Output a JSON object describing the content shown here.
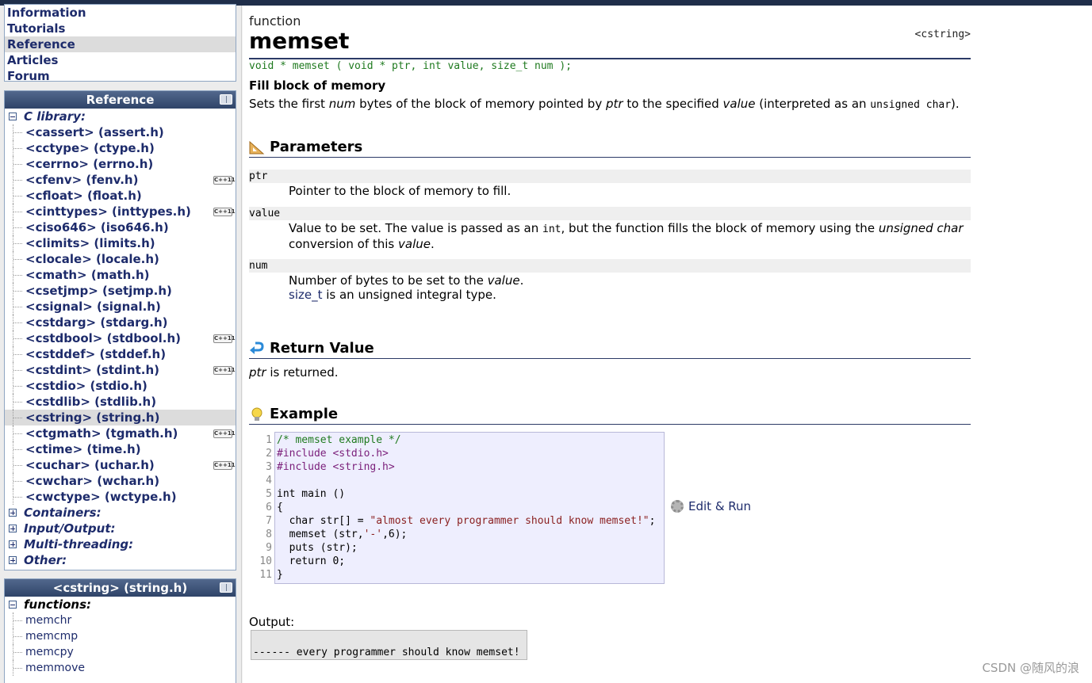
{
  "nav": {
    "items": [
      "Information",
      "Tutorials",
      "Reference",
      "Articles",
      "Forum"
    ],
    "active_index": 2
  },
  "reference_panel": {
    "title": "Reference",
    "c_library": "C library:",
    "headers": [
      {
        "label": "<cassert> (assert.h)",
        "cpp11": false
      },
      {
        "label": "<cctype> (ctype.h)",
        "cpp11": false
      },
      {
        "label": "<cerrno> (errno.h)",
        "cpp11": false
      },
      {
        "label": "<cfenv> (fenv.h)",
        "cpp11": true
      },
      {
        "label": "<cfloat> (float.h)",
        "cpp11": false
      },
      {
        "label": "<cinttypes> (inttypes.h)",
        "cpp11": true
      },
      {
        "label": "<ciso646> (iso646.h)",
        "cpp11": false
      },
      {
        "label": "<climits> (limits.h)",
        "cpp11": false
      },
      {
        "label": "<clocale> (locale.h)",
        "cpp11": false
      },
      {
        "label": "<cmath> (math.h)",
        "cpp11": false
      },
      {
        "label": "<csetjmp> (setjmp.h)",
        "cpp11": false
      },
      {
        "label": "<csignal> (signal.h)",
        "cpp11": false
      },
      {
        "label": "<cstdarg> (stdarg.h)",
        "cpp11": false
      },
      {
        "label": "<cstdbool> (stdbool.h)",
        "cpp11": true
      },
      {
        "label": "<cstddef> (stddef.h)",
        "cpp11": false
      },
      {
        "label": "<cstdint> (stdint.h)",
        "cpp11": true
      },
      {
        "label": "<cstdio> (stdio.h)",
        "cpp11": false
      },
      {
        "label": "<cstdlib> (stdlib.h)",
        "cpp11": false
      },
      {
        "label": "<cstring> (string.h)",
        "cpp11": false
      },
      {
        "label": "<ctgmath> (tgmath.h)",
        "cpp11": true
      },
      {
        "label": "<ctime> (time.h)",
        "cpp11": false
      },
      {
        "label": "<cuchar> (uchar.h)",
        "cpp11": true
      },
      {
        "label": "<cwchar> (wchar.h)",
        "cpp11": false
      },
      {
        "label": "<cwctype> (wctype.h)",
        "cpp11": false
      }
    ],
    "active_index": 18,
    "cpp11_badge": "C++11",
    "categories": [
      "Containers:",
      "Input/Output:",
      "Multi-threading:",
      "Other:"
    ]
  },
  "cstring_panel": {
    "title": "<cstring> (string.h)",
    "functions_label": "functions:",
    "functions": [
      "memchr",
      "memcmp",
      "memcpy",
      "memmove"
    ]
  },
  "page": {
    "kind": "function",
    "title": "memset",
    "header": "<cstring>",
    "prototype": "void * memset ( void * ptr, int value, size_t num );",
    "summary": "Fill block of memory",
    "desc_1": "Sets the first ",
    "desc_num": "num",
    "desc_2": " bytes of the block of memory pointed by ",
    "desc_ptr": "ptr",
    "desc_3": " to the specified ",
    "desc_value": "value",
    "desc_4": " (interpreted as an ",
    "desc_code": "unsigned char",
    "desc_5": ")."
  },
  "parameters": {
    "heading": "Parameters",
    "ptr_name": "ptr",
    "ptr_desc": "Pointer to the block of memory to fill.",
    "value_name": "value",
    "value_desc_1": "Value to be set. The value is passed as an ",
    "value_desc_int": "int",
    "value_desc_2": ", but the function fills the block of memory using the ",
    "value_desc_uc": "unsigned char",
    "value_desc_3": "conversion of this ",
    "value_desc_value": "value",
    "value_desc_4": ".",
    "num_name": "num",
    "num_desc_1": "Number of bytes to be set to the ",
    "num_desc_value": "value",
    "num_desc_2": ".",
    "num_desc_link": "size_t",
    "num_desc_3": " is an unsigned integral type."
  },
  "return_value": {
    "heading": "Return Value",
    "ptr": "ptr",
    "text": " is returned."
  },
  "example": {
    "heading": "Example",
    "line_numbers": [
      "1",
      "2",
      "3",
      "4",
      "5",
      "6",
      "7",
      "8",
      "9",
      "10",
      "11"
    ],
    "code": {
      "l1": "/* memset example */",
      "l2": "#include <stdio.h>",
      "l3": "#include <string.h>",
      "l5": "int main ()",
      "l6": "{",
      "l7a": "  char str[] = ",
      "l7b": "\"almost every programmer should know memset!\"",
      "l7c": ";",
      "l8a": "  memset (str,",
      "l8b": "'-'",
      "l8c": ",6);",
      "l9": "  puts (str);",
      "l10": "  return 0;",
      "l11": "}"
    },
    "edit_run": "Edit & Run",
    "output_label": "Output:",
    "output": "------ every programmer should know memset!"
  },
  "watermark": "CSDN @随风的浪"
}
